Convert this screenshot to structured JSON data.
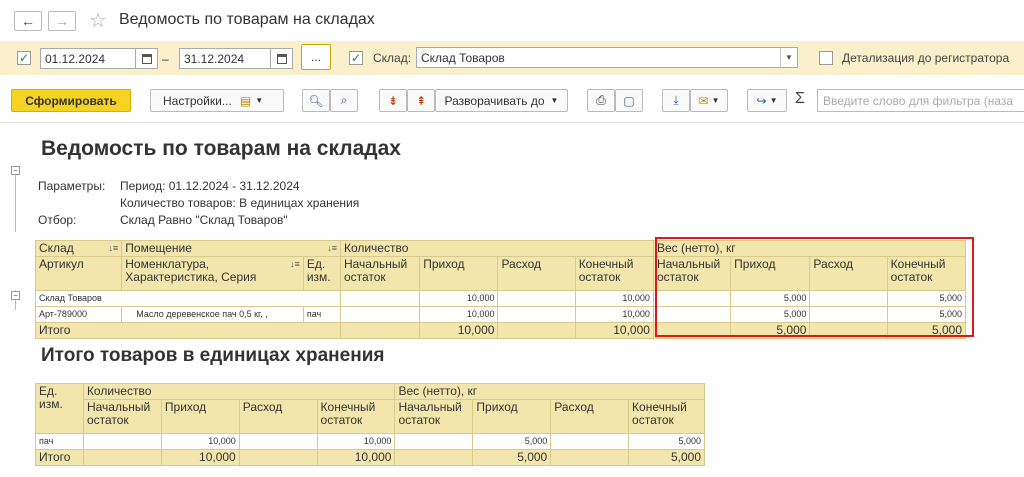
{
  "window": {
    "title": "Ведомость по товарам на складах",
    "back_icon": "←",
    "forward_icon": "→",
    "star_icon": "☆"
  },
  "filter": {
    "date_from": "01.12.2024",
    "date_to": "31.12.2024",
    "dash": "–",
    "dots_label": "...",
    "warehouse_label": "Склад:",
    "warehouse_value": "Склад Товаров",
    "detail_label": "Детализация до регистратора",
    "check_mark": "✓"
  },
  "toolbar": {
    "generate_label": "Сформировать",
    "settings_label": "Настройки...",
    "expand_label": "Разворачивать до",
    "search_placeholder": "Введите слово для фильтра (наза",
    "sigma": "Σ"
  },
  "report": {
    "title": "Ведомость по товарам на складах",
    "params_label": "Параметры:",
    "params_period": "Период: 01.12.2024 - 31.12.2024",
    "params_qty": "Количество товаров: В единицах хранения",
    "filter_label": "Отбор:",
    "filter_value": "Склад Равно \"Склад Товаров\"",
    "table1": {
      "h_warehouse": "Склад",
      "h_room": "Помещение",
      "h_qty": "Количество",
      "h_weight": "Вес (нетто), кг",
      "h_article": "Артикул",
      "h_nomenclature": "Номенклатура, Характеристика, Серия",
      "h_unit": "Ед. изм.",
      "h_start": "Начальный остаток",
      "h_income": "Приход",
      "h_expense": "Расход",
      "h_end": "Конечный остаток",
      "group_name": "Склад Товаров",
      "group_qty_income": "10,000",
      "group_qty_end": "10,000",
      "group_w_income": "5,000",
      "group_w_end": "5,000",
      "row_article": "Арт-789000",
      "row_name": "Масло деревенское пач 0,5 кг, ,",
      "row_unit": "пач",
      "row_qty_income": "10,000",
      "row_qty_end": "10,000",
      "row_w_income": "5,000",
      "row_w_end": "5,000",
      "total_label": "Итого",
      "total_qty_income": "10,000",
      "total_qty_end": "10,000",
      "total_w_income": "5,000",
      "total_w_end": "5,000"
    },
    "title2": "Итого товаров в единицах хранения",
    "table2": {
      "h_unit": "Ед. изм.",
      "h_qty": "Количество",
      "h_weight": "Вес (нетто), кг",
      "h_start": "Начальный остаток",
      "h_income": "Приход",
      "h_expense": "Расход",
      "h_end": "Конечный остаток",
      "row_unit": "пач",
      "row_qty_income": "10,000",
      "row_qty_end": "10,000",
      "row_w_income": "5,000",
      "row_w_end": "5,000",
      "total_label": "Итого",
      "total_qty_income": "10,000",
      "total_qty_end": "10,000",
      "total_w_income": "5,000",
      "total_w_end": "5,000"
    }
  },
  "colors": {
    "accent_yellow": "#f5d320",
    "header_bg": "#f3e6ac",
    "filter_bg": "#fbf0cc",
    "highlight": "#e0171a"
  }
}
